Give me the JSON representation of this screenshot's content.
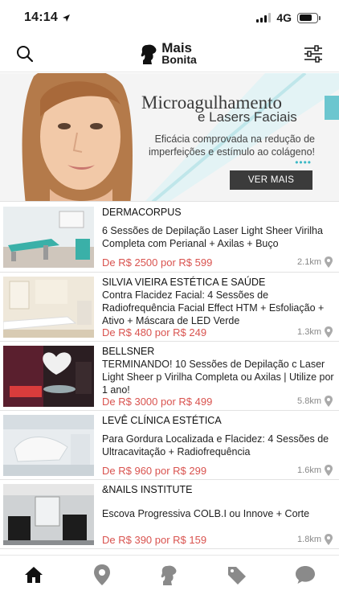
{
  "status_bar": {
    "time": "14:14",
    "network": "4G",
    "battery_level": 0.75
  },
  "header": {
    "logo_line1": "Mais",
    "logo_line2": "Bonita"
  },
  "banner": {
    "title": "Microagulhamento",
    "subtitle": "e Lasers Faciais",
    "description": "Eficácia comprovada na redução de imperfeições e estímulo ao colágeno!",
    "button_label": "VER MAIS",
    "dots": "••••"
  },
  "deals": [
    {
      "name": "DERMACORPUS",
      "desc": "6 Sessões de Depilação Laser Light Sheer Virilha Completa com Perianal + Axilas + Buço",
      "price": "De R$ 2500 por R$ 599",
      "distance": "2.1km"
    },
    {
      "name": "SILVIA VIEIRA ESTÉTICA E SAÚDE",
      "desc": "Contra Flacidez Facial: 4 Sessões de Radiofrequência Facial Effect HTM + Esfoliação + Ativo + Máscara de LED Verde",
      "price": "De R$ 480 por R$ 249",
      "distance": "1.3km"
    },
    {
      "name": "BELLSNER",
      "desc": "TERMINANDO! 10 Sessões de Depilação c Laser Light Sheer p Virilha Completa ou Axilas | Utilize por 1 ano!",
      "price": "De R$ 3000 por R$ 499",
      "distance": "5.8km"
    },
    {
      "name": "LEVÊ CLÍNICA ESTÉTICA",
      "desc": "Para Gordura Localizada e Flacidez: 4 Sessões de Ultracavitação + Radiofrequência",
      "price": "De R$ 960 por R$ 299",
      "distance": "1.6km"
    },
    {
      "name": "&NAILS INSTITUTE",
      "desc": "Escova Progressiva COLB.I ou Innove + Corte",
      "price": "De R$ 390 por R$ 159",
      "distance": "1.8km"
    }
  ],
  "tabs": [
    "home-icon",
    "map-pin-icon",
    "woman-profile-icon",
    "tags-icon",
    "chat-bubble-icon"
  ],
  "colors": {
    "price": "#d9534f",
    "accent": "#3cb9c6",
    "active_tab": "#111111",
    "inactive_tab": "#8a8a8a"
  }
}
